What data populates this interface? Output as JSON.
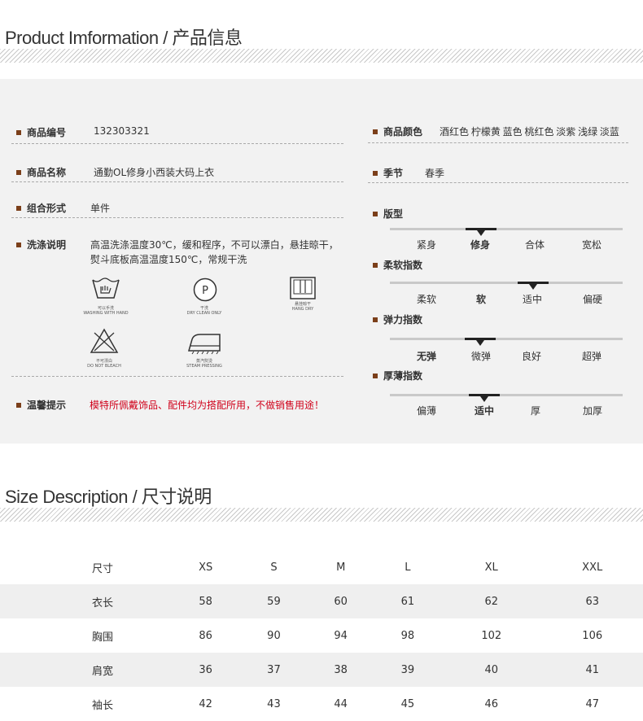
{
  "product_section": {
    "title": "Product Imformation / 产品信息",
    "fields": {
      "code": {
        "label": "商品编号",
        "value": "132303321"
      },
      "name": {
        "label": "商品名称",
        "value": "通勤OL修身小西装大码上衣"
      },
      "combo": {
        "label": "组合形式",
        "value": "单件"
      },
      "wash": {
        "label": "洗涤说明",
        "value_line1": "高温洗涤温度30℃，缓和程序，不可以漂白，悬挂晾干，",
        "value_line2": "熨斗底板高温温度150℃，常规干洗"
      },
      "tip": {
        "label": "温馨提示",
        "value": "模特所佩戴饰品、配件均为搭配所用，不做销售用途！",
        "color": "#d0021b"
      },
      "colors": {
        "label": "商品颜色",
        "value": "酒红色 柠檬黄 蓝色 桃红色 淡紫  浅绿  淡蓝"
      },
      "season": {
        "label": "季节",
        "value": "春季"
      },
      "fit": {
        "label": "版型",
        "options": [
          "紧身",
          "修身",
          "合体",
          "宽松"
        ],
        "selected": 1
      },
      "softness": {
        "label": "柔软指数",
        "options": [
          "柔软",
          "软",
          "适中",
          "偏硬"
        ],
        "selected": 2
      },
      "elasticity": {
        "label": "弹力指数",
        "options": [
          "无弹",
          "微弹",
          "良好",
          "超弹"
        ],
        "selected": 1
      },
      "thickness": {
        "label": "厚薄指数",
        "options": [
          "偏薄",
          "适中",
          "厚",
          "加厚"
        ],
        "selected": 1
      }
    },
    "care_icons": [
      {
        "icon": "hand-wash-icon",
        "caption1": "可以手洗",
        "caption2": "WASHING WITH HAND"
      },
      {
        "icon": "dry-clean-icon",
        "symbol": "P",
        "caption1": "干洗",
        "caption2": "DRY CLEAN ONLY"
      },
      {
        "icon": "hang-dry-icon",
        "caption1": "悬挂晾干",
        "caption2": "HANG DRY"
      },
      {
        "icon": "no-bleach-icon",
        "caption1": "不可漂白",
        "caption2": "DO NOT BLEACH"
      },
      {
        "icon": "steam-iron-icon",
        "caption1": "蒸汽熨烫",
        "caption2": "STEAM PRESSING"
      }
    ],
    "accent_color": "#7b3f1a"
  },
  "size_section": {
    "title": "Size Description / 尺寸说明",
    "headers": [
      "尺寸",
      "XS",
      "S",
      "M",
      "L",
      "XL",
      "XXL"
    ],
    "rows": [
      [
        "衣长",
        "58",
        "59",
        "60",
        "61",
        "62",
        "63"
      ],
      [
        "胸围",
        "86",
        "90",
        "94",
        "98",
        "102",
        "106"
      ],
      [
        "肩宽",
        "36",
        "37",
        "38",
        "39",
        "40",
        "41"
      ],
      [
        "袖长",
        "42",
        "43",
        "44",
        "45",
        "46",
        "47"
      ]
    ]
  }
}
